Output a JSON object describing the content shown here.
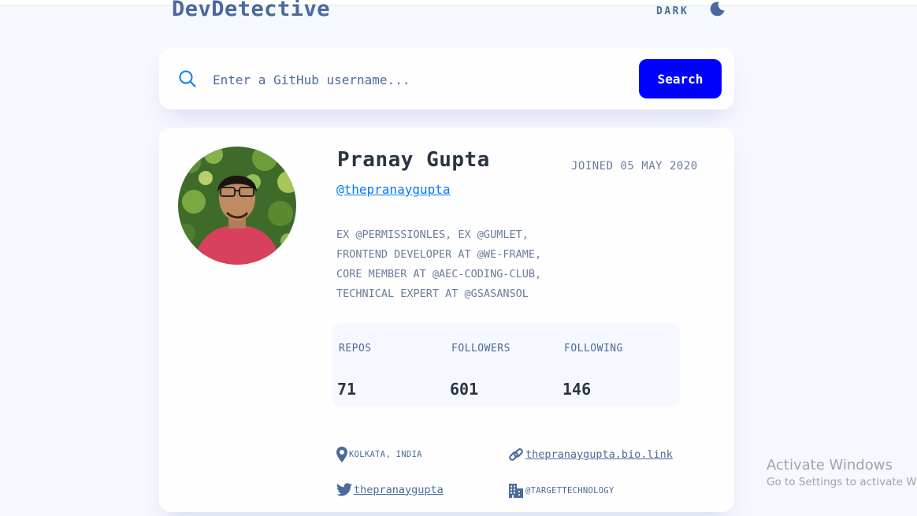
{
  "app": {
    "title": "DevDetective",
    "theme_toggle_label": "DARK"
  },
  "search": {
    "placeholder": "Enter a GitHub username...",
    "value": "",
    "button_label": "Search"
  },
  "profile": {
    "name": "Pranay Gupta",
    "handle": "@thepranaygupta",
    "joined": "JOINED 05 MAY 2020",
    "bio_lines": [
      "EX @PERMISSIONLES, EX @GUMLET,",
      "FRONTEND DEVELOPER AT @WE-FRAME,",
      "CORE MEMBER AT @AEC-CODING-CLUB,",
      "TECHNICAL EXPERT AT @GSASANSOL"
    ],
    "stats": [
      {
        "label": "REPOS",
        "value": "71"
      },
      {
        "label": "FOLLOWERS",
        "value": "601"
      },
      {
        "label": "FOLLOWING",
        "value": "146"
      }
    ],
    "location": "KOLKATA, INDIA",
    "website": "thepranaygupta.bio.link",
    "twitter": "thepranaygupta",
    "company": "@TARGETTECHNOLOGY"
  },
  "watermark": {
    "title": "Activate Windows",
    "subtitle": "Go to Settings to activate Wi"
  },
  "icons": {
    "search": "search-icon",
    "theme": "moon-icon",
    "location": "location-pin-icon",
    "website": "link-icon",
    "twitter": "twitter-icon",
    "company": "building-icon"
  },
  "colors": {
    "page_background": "#f6f8ff",
    "card_background": "#fefefe",
    "accent_blue": "#0000ff",
    "link_blue": "#0079ff",
    "title_color": "#4b6a9b",
    "text_dark": "#2b3442",
    "text_muted": "#697c9a"
  }
}
